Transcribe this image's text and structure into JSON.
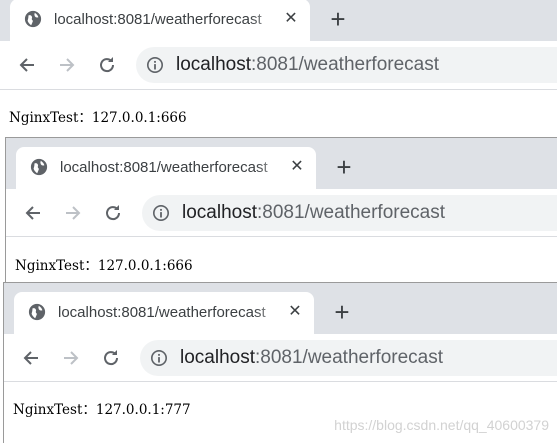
{
  "windows": [
    {
      "tab_title": "localhost:8081/weatherforecast",
      "tab_close": "✕",
      "new_tab": "+",
      "url_host": "localhost",
      "url_rest": ":8081/weatherforecast",
      "page_text": "NginxTest：127.0.0.1:666"
    },
    {
      "tab_title": "localhost:8081/weatherforecast",
      "tab_close": "✕",
      "new_tab": "+",
      "url_host": "localhost",
      "url_rest": ":8081/weatherforecast",
      "page_text": "NginxTest：127.0.0.1:666"
    },
    {
      "tab_title": "localhost:8081/weatherforecast",
      "tab_close": "✕",
      "new_tab": "+",
      "url_host": "localhost",
      "url_rest": ":8081/weatherforecast",
      "page_text": "NginxTest：127.0.0.1:777"
    }
  ],
  "watermark": "https://blog.csdn.net/qq_40600379",
  "colors": {
    "tabstrip": "#dee1e6",
    "omnibox": "#f1f3f4",
    "icon": "#5f6368",
    "icon_disabled": "#bdc1c6"
  }
}
